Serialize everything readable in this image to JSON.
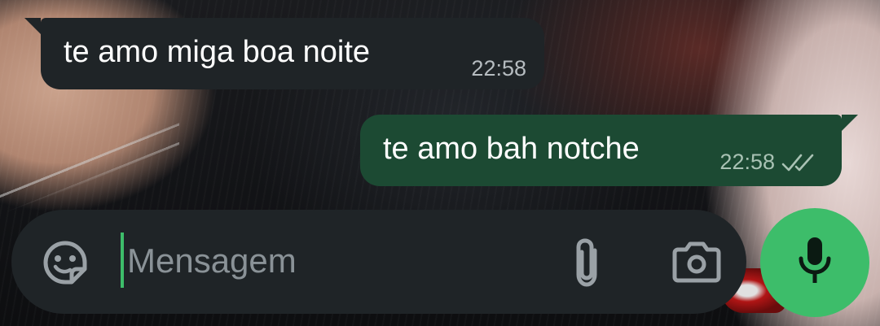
{
  "messages": [
    {
      "direction": "incoming",
      "text": "te amo miga boa noite",
      "time": "22:58"
    },
    {
      "direction": "outgoing",
      "text": "te amo bah notche",
      "time": "22:58",
      "status_icon": "double-check-icon"
    }
  ],
  "composer": {
    "placeholder": "Mensagem",
    "value": "",
    "emoji_icon": "sticker-emoji-icon",
    "attach_icon": "paperclip-icon",
    "camera_icon": "camera-icon",
    "mic_icon": "microphone-icon"
  },
  "colors": {
    "incoming_bubble": "#1f2427",
    "outgoing_bubble": "#1c4a33",
    "accent": "#3dbd6a",
    "input_bar": "#1f2427"
  }
}
